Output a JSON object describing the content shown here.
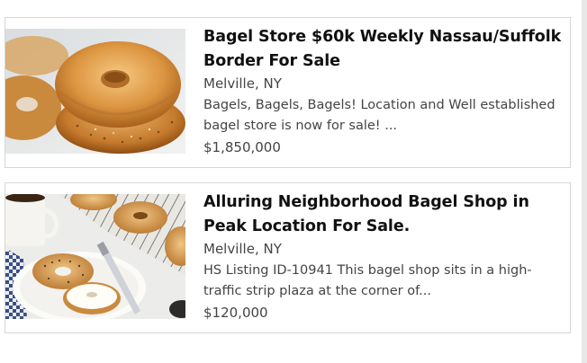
{
  "listings": [
    {
      "title": "Bagel Store $60k Weekly Nassau/Suffolk Border For Sale",
      "location": "Melville, NY",
      "description": "Bagels, Bagels, Bagels! Location and Well established bagel store is now for sale! ...",
      "price": "$1,850,000",
      "image": "bagel-stack-photo"
    },
    {
      "title": "Alluring Neighborhood Bagel Shop in Peak Location For Sale.",
      "location": "Melville, NY",
      "description": "HS Listing ID-10941 This bagel shop sits in a high-traffic strip plaza at the corner of...",
      "price": "$120,000",
      "image": "bagels-with-cream-cheese-photo"
    }
  ]
}
